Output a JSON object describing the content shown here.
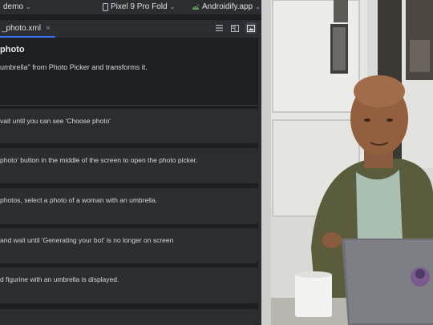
{
  "topbar": {
    "project_label": "demo",
    "device_label": "Pixel 9 Pro Fold",
    "app_label": "Androidify.app"
  },
  "tabs": [
    {
      "label": "_photo.xml",
      "close_glyph": "×"
    }
  ],
  "view_buttons": [
    "list-view-icon",
    "split-view-icon",
    "preview-view-icon"
  ],
  "document": {
    "heading": "photo",
    "intro": "umbrella\" from Photo Picker and transforms it.",
    "steps": [
      "vait until you can see 'Choose photo'",
      "photo' button in the middle of the screen to open the photo picker.",
      "photos, select a photo of a woman with an umbrella.",
      "and wait until 'Generating your bot' is no longer on screen",
      "d figurine with an umbrella is displayed."
    ]
  },
  "colors": {
    "ide_bg": "#1e1f22",
    "panel_bg": "#2b2d30",
    "accent": "#3574f0",
    "app_icon_green": "#5ea35c"
  }
}
